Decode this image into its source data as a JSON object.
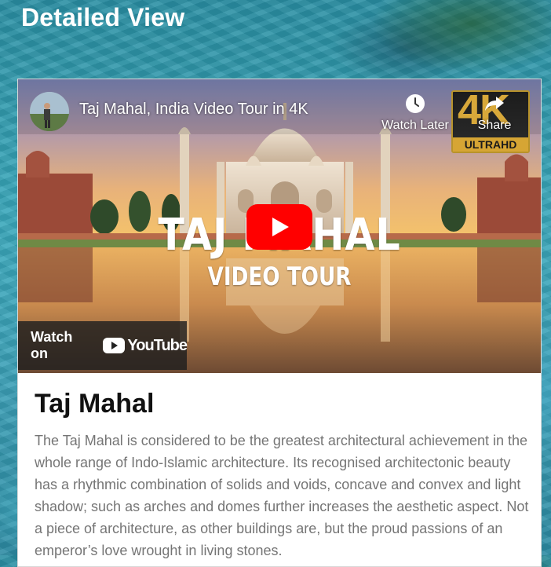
{
  "page": {
    "title": "Detailed View"
  },
  "video": {
    "title": "Taj Mahal, India Video Tour in 4K",
    "watch_later_label": "Watch Later",
    "share_label": "Share",
    "badge_main": "4K",
    "badge_sub": "ULTRAHD",
    "overlay_title": "TAJ MAHAL",
    "overlay_subtitle": "VIDEO TOUR",
    "watch_on_label": "Watch on",
    "youtube_wordmark": "YouTube",
    "play_color": "#ff0000"
  },
  "card": {
    "title": "Taj Mahal",
    "description": "The Taj Mahal is considered to be the greatest architectural achievement in the whole range of Indo-Islamic architecture. Its recognised architectonic beauty has a rhythmic combination of solids and voids, concave and convex and light shadow; such as arches and domes further increases the aesthetic aspect. Not a piece of architecture, as other buildings are, but the proud passions of an emperor’s love wrought in living stones."
  },
  "icons": [
    "avatar",
    "clock-icon",
    "share-icon",
    "play-icon",
    "youtube-logo-icon"
  ]
}
